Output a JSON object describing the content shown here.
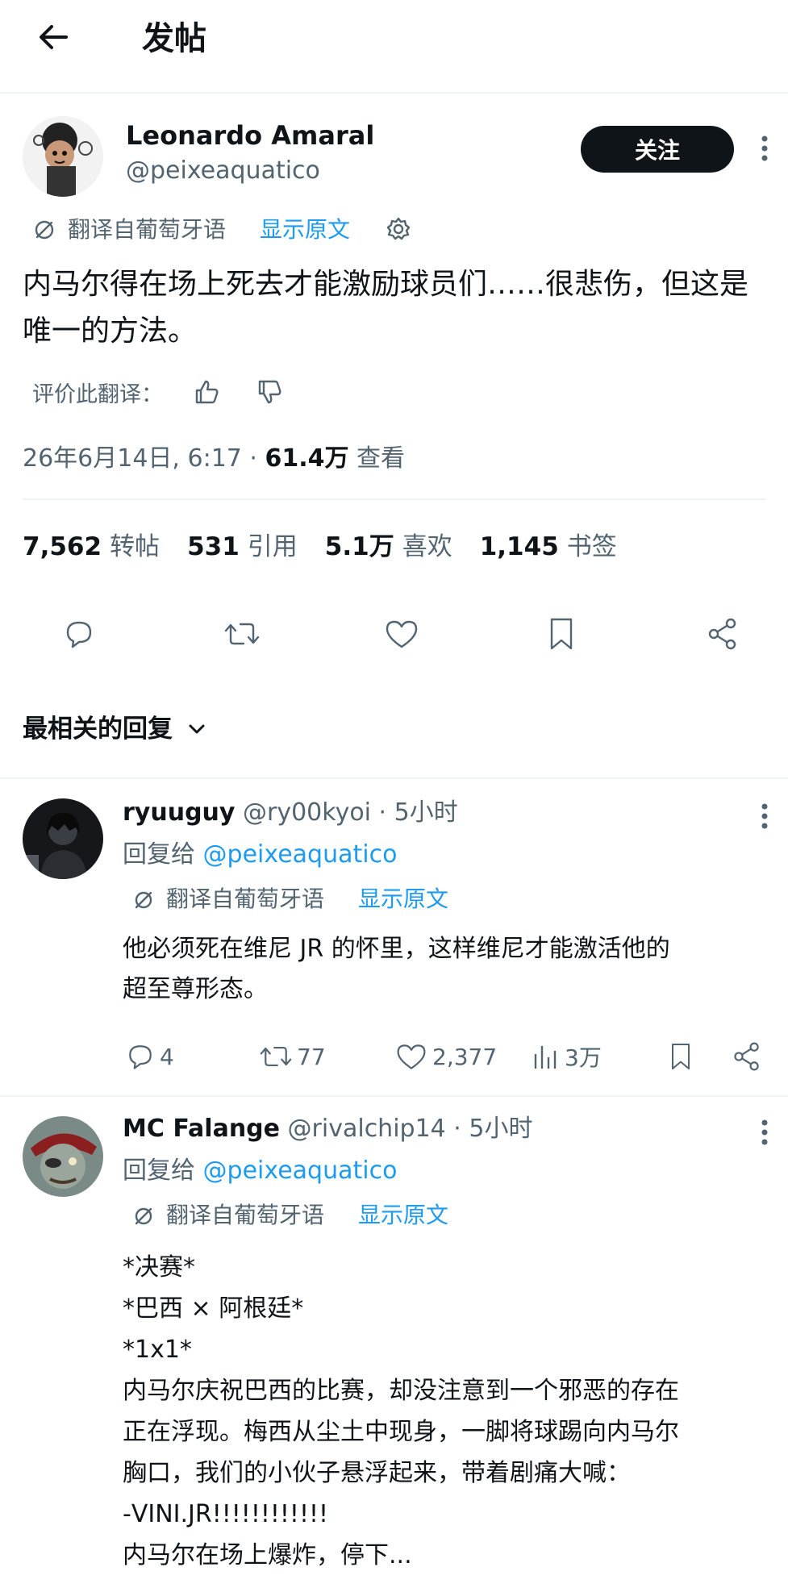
{
  "header": {
    "title": "发帖"
  },
  "post": {
    "author_name": "Leonardo Amaral",
    "author_handle": "@peixeaquatico",
    "follow_label": "关注",
    "translated_from": "翻译自葡萄牙语",
    "show_original": "显示原文",
    "body": "内马尔得在场上死去才能激励球员们……很悲伤，但这是唯一的方法。",
    "rate_translation": "评价此翻译：",
    "timestamp": "26年6月14日, 6:17 · ",
    "views_count": "61.4万",
    "views_label": " 查看",
    "stats": {
      "reposts_num": "7,562",
      "reposts_label": "转帖",
      "quotes_num": "531",
      "quotes_label": "引用",
      "likes_num": "5.1万",
      "likes_label": "喜欢",
      "bookmarks_num": "1,145",
      "bookmarks_label": "书签"
    }
  },
  "replies_sort": {
    "label": "最相关的回复"
  },
  "replies": [
    {
      "name": "ryuuguy",
      "handle_time": "@ry00kyoi · 5小时",
      "reply_to_prefix": "回复给 ",
      "reply_to_handle": "@peixeaquatico",
      "translated_from": "翻译自葡萄牙语",
      "show_original": "显示原文",
      "text": "他必须死在维尼 JR 的怀里，这样维尼才能激活他的\n超至尊形态。",
      "replies_count": "4",
      "reposts_count": "77",
      "likes_count": "2,377",
      "views_count": "3万"
    },
    {
      "name": "MC Falange",
      "handle_time": "@rivalchip14 · 5小时",
      "reply_to_prefix": "回复给 ",
      "reply_to_handle": "@peixeaquatico",
      "translated_from": "翻译自葡萄牙语",
      "show_original": "显示原文",
      "text": "*决赛*\n*巴西 × 阿根廷*\n*1x1*\n内马尔庆祝巴西的比赛，却没注意到一个邪恶的存在\n正在浮现。梅西从尘土中现身，一脚将球踢向内马尔\n胸口，我们的小伙子悬浮起来，带着剧痛大喊：\n-VINI.JR!!!!!!!!!!!!\n内马尔在场上爆炸，停下..."
    }
  ],
  "colors": {
    "accent": "#1d9bf0",
    "text": "#0f1419",
    "muted": "#536471",
    "divider": "#eff3f4"
  }
}
